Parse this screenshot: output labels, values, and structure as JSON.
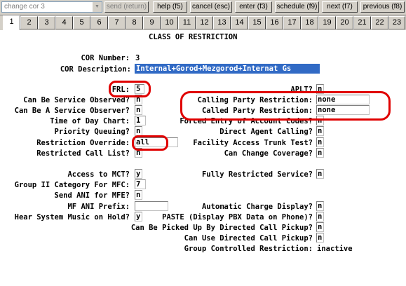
{
  "toolbar": {
    "command_value": "change cor 3",
    "send_label": "send (return)",
    "help_label": "help (f5)",
    "cancel_label": "cancel (esc)",
    "enter_label": "enter (f3)",
    "schedule_label": "schedule (f9)",
    "next_label": "next (f7)",
    "previous_label": "previous (f8)"
  },
  "tabs": [
    "1",
    "2",
    "3",
    "4",
    "5",
    "6",
    "7",
    "8",
    "9",
    "10",
    "11",
    "12",
    "13",
    "14",
    "15",
    "16",
    "17",
    "18",
    "19",
    "20",
    "21",
    "22",
    "23"
  ],
  "form": {
    "title": "CLASS OF RESTRICTION",
    "cor_number_label": "COR Number:",
    "cor_number_value": "3",
    "cor_description_label": "COR Description:",
    "cor_description_value": "Internal+Gorod+Mezgorod+Internat Gs",
    "frl_label": "FRL:",
    "frl_value": "5",
    "apli_label": "APLT?",
    "apli_value": "n",
    "can_be_service_observed_label": "Can Be Service Observed?",
    "can_be_service_observed_value": "n",
    "calling_party_restriction_label": "Calling Party Restriction:",
    "calling_party_restriction_value": "none",
    "can_be_a_service_observer_label": "Can Be A Service Observer?",
    "can_be_a_service_observer_value": "n",
    "called_party_restriction_label": "Called Party Restriction:",
    "called_party_restriction_value": "none",
    "time_of_day_chart_label": "Time of Day Chart:",
    "time_of_day_chart_value": "1",
    "forced_entry_label": "Forced Entry of Account Codes?",
    "forced_entry_value": "n",
    "priority_queuing_label": "Priority Queuing?",
    "priority_queuing_value": "n",
    "direct_agent_calling_label": "Direct Agent Calling?",
    "direct_agent_calling_value": "n",
    "restriction_override_label": "Restriction Override:",
    "restriction_override_value": "all",
    "facility_access_trunk_test_label": "Facility Access Trunk Test?",
    "facility_access_trunk_test_value": "n",
    "restricted_call_list_label": "Restricted Call List?",
    "restricted_call_list_value": "n",
    "can_change_coverage_label": "Can Change Coverage?",
    "can_change_coverage_value": "n",
    "access_to_mct_label": "Access to MCT?",
    "access_to_mct_value": "y",
    "fully_restricted_service_label": "Fully Restricted Service?",
    "fully_restricted_service_value": "n",
    "group_ii_category_label": "Group II Category For MFC:",
    "group_ii_category_value": "7",
    "send_ani_label": "Send ANI for MFE?",
    "send_ani_value": "n",
    "mf_ani_prefix_label": "MF ANI Prefix:",
    "mf_ani_prefix_value": "",
    "automatic_charge_display_label": "Automatic Charge Display?",
    "automatic_charge_display_value": "n",
    "hear_system_music_label": "Hear System Music on Hold?",
    "hear_system_music_value": "y",
    "paste_label": "PASTE (Display PBX Data on Phone)?",
    "paste_value": "n",
    "can_be_picked_up_label": "Can Be Picked Up By Directed Call Pickup?",
    "can_be_picked_up_value": "n",
    "can_use_directed_call_pickup_label": "Can Use Directed Call Pickup?",
    "can_use_directed_call_pickup_value": "n",
    "group_controlled_restriction_label": "Group Controlled Restriction:",
    "group_controlled_restriction_value": "inactive"
  },
  "colors": {
    "annotation_red": "#e00000",
    "selection_blue": "#316ac5"
  }
}
